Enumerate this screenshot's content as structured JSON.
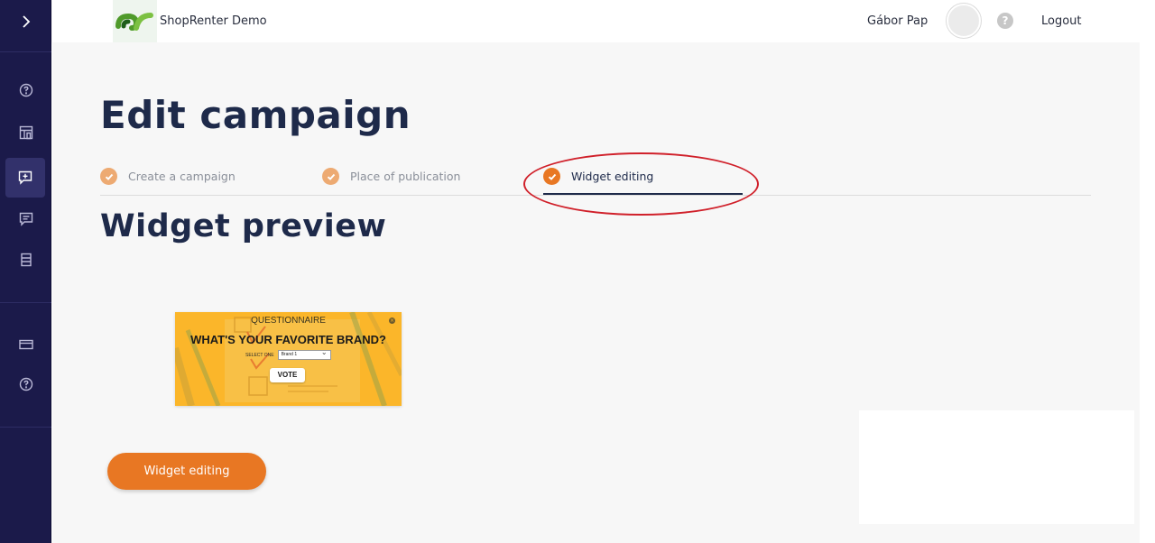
{
  "header": {
    "shop_name": "ShopRenter Demo",
    "user_name": "Gábor Pap",
    "help_symbol": "?",
    "logout_label": "Logout"
  },
  "sidebar": {
    "icons": [
      "chevron-right-icon",
      "question-circle-icon",
      "layout-icon",
      "comment-plus-icon",
      "comment-icon",
      "archive-icon",
      "credit-card-icon",
      "question-circle-icon"
    ],
    "active_item": "comment-plus-icon"
  },
  "page": {
    "title": "Edit campaign",
    "steps": [
      {
        "label": "Create a campaign",
        "state": "done"
      },
      {
        "label": "Place of publication",
        "state": "done"
      },
      {
        "label": "Widget editing",
        "state": "active"
      }
    ],
    "preview_title": "Widget preview",
    "edit_button_label": "Widget editing"
  },
  "widget": {
    "header": "QUESTIONNAIRE",
    "close_symbol": "×",
    "question": "WHAT'S YOUR FAVORITE BRAND?",
    "select_label": "SELECT ONE",
    "select_value": "Brand 1",
    "vote_label": "VOTE"
  },
  "colors": {
    "sidebar_bg": "#1b1a4a",
    "accent": "#e87723",
    "title": "#1e2a4a",
    "widget_bg": "#fbb62a",
    "annotation": "#d0202a"
  }
}
